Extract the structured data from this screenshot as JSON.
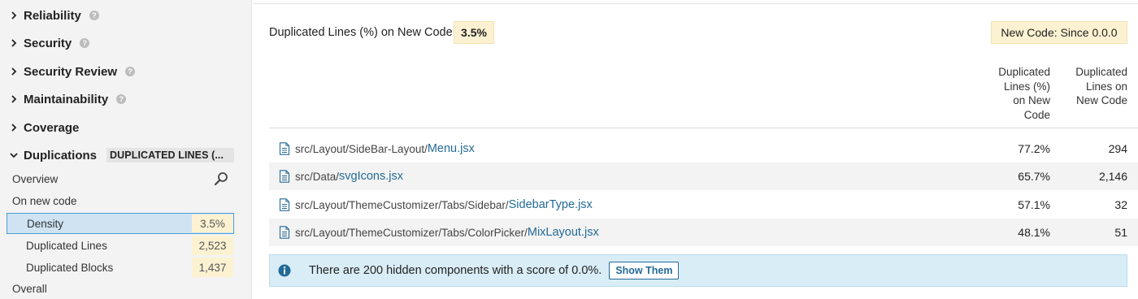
{
  "sidebar": {
    "categories": [
      {
        "label": "Reliability",
        "expanded": false,
        "help": "?"
      },
      {
        "label": "Security",
        "expanded": false,
        "help": "?"
      },
      {
        "label": "Security Review",
        "expanded": false,
        "help": "?"
      },
      {
        "label": "Maintainability",
        "expanded": false,
        "help": "?"
      },
      {
        "label": "Coverage",
        "expanded": false
      },
      {
        "label": "Duplications",
        "expanded": true,
        "badge": "DUPLICATED LINES (..."
      }
    ],
    "overview_label": "Overview",
    "on_new_code_label": "On new code",
    "metrics": [
      {
        "label": "Density",
        "value": "3.5%",
        "selected": true
      },
      {
        "label": "Duplicated Lines",
        "value": "2,523",
        "selected": false
      },
      {
        "label": "Duplicated Blocks",
        "value": "1,437",
        "selected": false
      }
    ],
    "overall_label": "Overall"
  },
  "header": {
    "measure_title": "Duplicated Lines (%) on New Code",
    "measure_value": "3.5%",
    "new_code_period": "New Code: Since 0.0.0"
  },
  "table": {
    "columns": [
      {
        "lines": [
          "Duplicated",
          "Lines (%)",
          "on New",
          "Code"
        ]
      },
      {
        "lines": [
          "Duplicated",
          "Lines on",
          "New Code"
        ]
      }
    ],
    "rows": [
      {
        "dir": "src/Layout/SideBar-Layout/",
        "file": "Menu.jsx",
        "pct": "77.2%",
        "lines": "294"
      },
      {
        "dir": "src/Data/",
        "file": "svgIcons.jsx",
        "pct": "65.7%",
        "lines": "2,146"
      },
      {
        "dir": "src/Layout/ThemeCustomizer/Tabs/Sidebar/",
        "file": "SidebarType.jsx",
        "pct": "57.1%",
        "lines": "32"
      },
      {
        "dir": "src/Layout/ThemeCustomizer/Tabs/ColorPicker/",
        "file": "MixLayout.jsx",
        "pct": "48.1%",
        "lines": "51"
      }
    ]
  },
  "info": {
    "icon": "info-icon",
    "text": "There are 200 hidden components with a score of 0.0%.",
    "button_label": "Show Them"
  },
  "colors": {
    "link": "#236a97",
    "highlight": "#fcf2d2",
    "selected_bg": "#cfe3f2",
    "selected_border": "#4b9fd5",
    "info_bg": "#d9edf7"
  }
}
